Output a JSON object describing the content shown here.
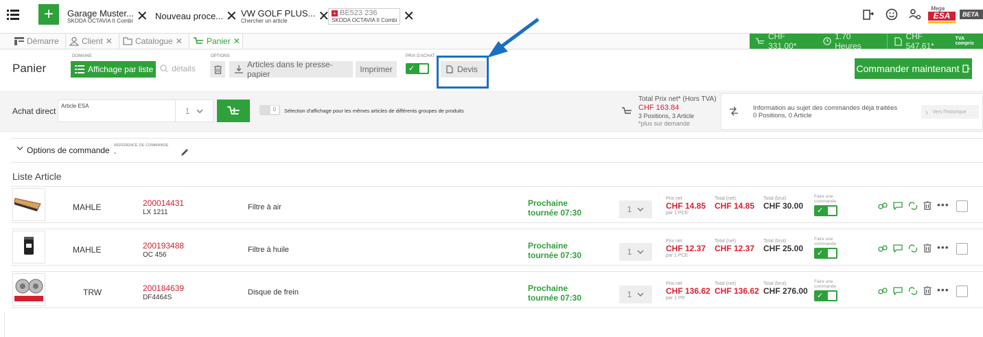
{
  "topbar": {
    "tabs": [
      {
        "title": "Garage Muster...",
        "sub": "SKODA OCTAVIA II Combi"
      },
      {
        "title": "Nouveau proce...",
        "sub": ""
      },
      {
        "title": "VW GOLF PLUS...",
        "sub": "Chercher un article"
      },
      {
        "title": "BE523 236",
        "sub": "SKODA OCTAVIA II Combi"
      }
    ],
    "brand": "ESA",
    "beta": "BETA"
  },
  "nav": {
    "tabs": [
      "Démarre",
      "Client",
      "Catalogue",
      "Panier"
    ],
    "summary": {
      "cart_total": "CHF 331.00*",
      "hours": "1.70 Heures",
      "quote_total": "CHF 547.61*",
      "vat": "TVA compris"
    }
  },
  "toolbar": {
    "page_title": "Panier",
    "domaine_label": "DOMAINE",
    "list_view": "Affichage par liste",
    "details": "détails",
    "options_label": "OPTIONS",
    "clipboard": "Articles dans le presse-papier",
    "print": "Imprimer",
    "purchase_price_label": "PRIX D'ACHAT",
    "quote": "Devis",
    "order_now": "Commander maintenant"
  },
  "direct": {
    "label": "Achat direct",
    "placeholder": "Article ESA",
    "qty": "1",
    "toggle_value": "0",
    "selection_text": "Sélection d'affichage pour les mêmes articles de différents groupes de produits",
    "total_label": "Total Prix net* (Hors TVA)",
    "total_value": "CHF 163.84",
    "positions": "3 Positions, 3 Article",
    "note": "*plus sur demande",
    "info_title": "Information au sujet des commandes déjà traitées",
    "info_sub": "0 Positions,  0 Article",
    "history": "Vers l'historique"
  },
  "options": {
    "label": "Options de commande",
    "ref_label": "RÉFÉRENCE DE COMMANDE",
    "ref_value": "-"
  },
  "list": {
    "title": "Liste Article",
    "col_net": "Prix net",
    "col_total_net": "Total (net)",
    "col_total_gross": "Total (brut)",
    "col_order": "Faire une commande",
    "items": [
      {
        "brand": "MAHLE",
        "number": "200014431",
        "ref": "LX 1211",
        "name": "Filtre à air",
        "delivery": "Prochaine tournée 07:30",
        "qty": "1",
        "net": "CHF 14.85",
        "unit": "par 1 PCE",
        "total_net": "CHF 14.85",
        "total_gross": "CHF 30.00"
      },
      {
        "brand": "MAHLE",
        "number": "200193488",
        "ref": "OC 456",
        "name": "Filtre à huile",
        "delivery": "Prochaine tournée 07:30",
        "qty": "1",
        "net": "CHF 12.37",
        "unit": "par 1 PCE",
        "total_net": "CHF 12.37",
        "total_gross": "CHF 25.00"
      },
      {
        "brand": "TRW",
        "number": "200184639",
        "ref": "DF4464S",
        "name": "Disque de frein",
        "delivery": "Prochaine tournée 07:30",
        "qty": "1",
        "net": "CHF 136.62",
        "unit": "par 1 PR",
        "total_net": "CHF 136.62",
        "total_gross": "CHF 276.00"
      }
    ]
  },
  "colors": {
    "accent": "#2ea13a",
    "price_red": "#d62030",
    "highlight_blue": "#1a6fc4"
  }
}
